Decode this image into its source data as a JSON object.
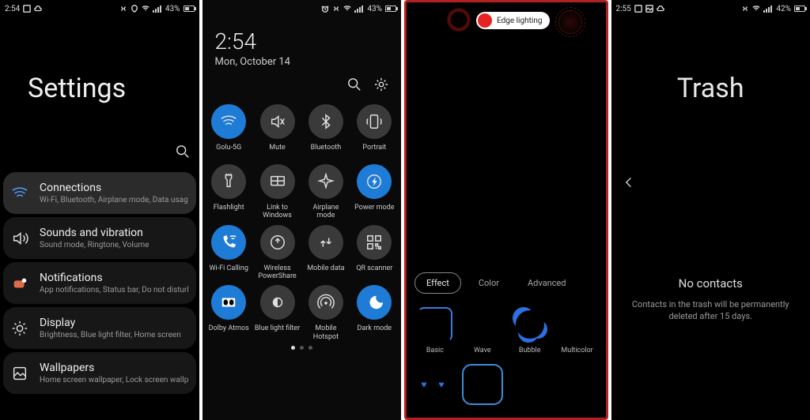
{
  "settings_screen": {
    "status": {
      "time": "2:54",
      "battery_pct": "43%"
    },
    "title": "Settings",
    "items": [
      {
        "icon": "wifi",
        "title": "Connections",
        "sub": "Wi-Fi, Bluetooth, Airplane mode, Data usage"
      },
      {
        "icon": "sound",
        "title": "Sounds and vibration",
        "sub": "Sound mode, Ringtone, Volume"
      },
      {
        "icon": "notif",
        "title": "Notifications",
        "sub": "App notifications, Status bar, Do not disturb"
      },
      {
        "icon": "display",
        "title": "Display",
        "sub": "Brightness, Blue light filter, Home screen"
      },
      {
        "icon": "wall",
        "title": "Wallpapers",
        "sub": "Home screen wallpaper, Lock screen wallpaper"
      }
    ]
  },
  "quick_panel": {
    "status": {
      "battery_pct": "43%"
    },
    "time": "2:54",
    "date": "Mon, October 14",
    "toggles": [
      {
        "id": "wifi",
        "label": "Golu-5G",
        "on": true
      },
      {
        "id": "mute",
        "label": "Mute",
        "on": false
      },
      {
        "id": "bluetooth",
        "label": "Bluetooth",
        "on": false
      },
      {
        "id": "portrait",
        "label": "Portrait",
        "on": false
      },
      {
        "id": "flashlight",
        "label": "Flashlight",
        "on": false
      },
      {
        "id": "linkwin",
        "label": "Link to Windows",
        "on": false
      },
      {
        "id": "airplane",
        "label": "Airplane mode",
        "on": false
      },
      {
        "id": "power",
        "label": "Power mode",
        "on": true
      },
      {
        "id": "wificall",
        "label": "Wi-Fi Calling",
        "on": true
      },
      {
        "id": "pshare",
        "label": "Wireless PowerShare",
        "on": false
      },
      {
        "id": "mdata",
        "label": "Mobile data",
        "on": false
      },
      {
        "id": "qr",
        "label": "QR scanner",
        "on": false
      },
      {
        "id": "dolby",
        "label": "Dolby Atmos",
        "on": true
      },
      {
        "id": "bluelight",
        "label": "Blue light filter",
        "on": false
      },
      {
        "id": "hotspot",
        "label": "Mobile Hotspot",
        "on": false
      },
      {
        "id": "dark",
        "label": "Dark mode",
        "on": true
      }
    ],
    "page_indicator": {
      "count": 3,
      "active": 0
    }
  },
  "edge_screen": {
    "toggle_label": "Edge lighting",
    "toggle_on": true,
    "tabs": [
      {
        "id": "effect",
        "label": "Effect",
        "active": true
      },
      {
        "id": "color",
        "label": "Color",
        "active": false
      },
      {
        "id": "advanced",
        "label": "Advanced",
        "active": false
      }
    ],
    "effects_row1": [
      {
        "id": "basic",
        "label": "Basic",
        "selected": false
      },
      {
        "id": "wave",
        "label": "Wave",
        "selected": false
      },
      {
        "id": "bubble",
        "label": "Bubble",
        "selected": false
      },
      {
        "id": "multi",
        "label": "Multicolor",
        "selected": false
      }
    ],
    "effects_row2": [
      {
        "id": "hearts",
        "label": "",
        "selected": false
      },
      {
        "id": "fire",
        "label": "",
        "selected": true
      },
      {
        "id": "glit",
        "label": "",
        "selected": false
      },
      {
        "id": "blank",
        "label": "",
        "selected": false
      }
    ]
  },
  "trash_screen": {
    "status": {
      "time": "2:55",
      "battery_pct": "42%"
    },
    "title": "Trash",
    "empty_title": "No contacts",
    "empty_sub": "Contacts in the trash will be permanently deleted after 15 days."
  }
}
